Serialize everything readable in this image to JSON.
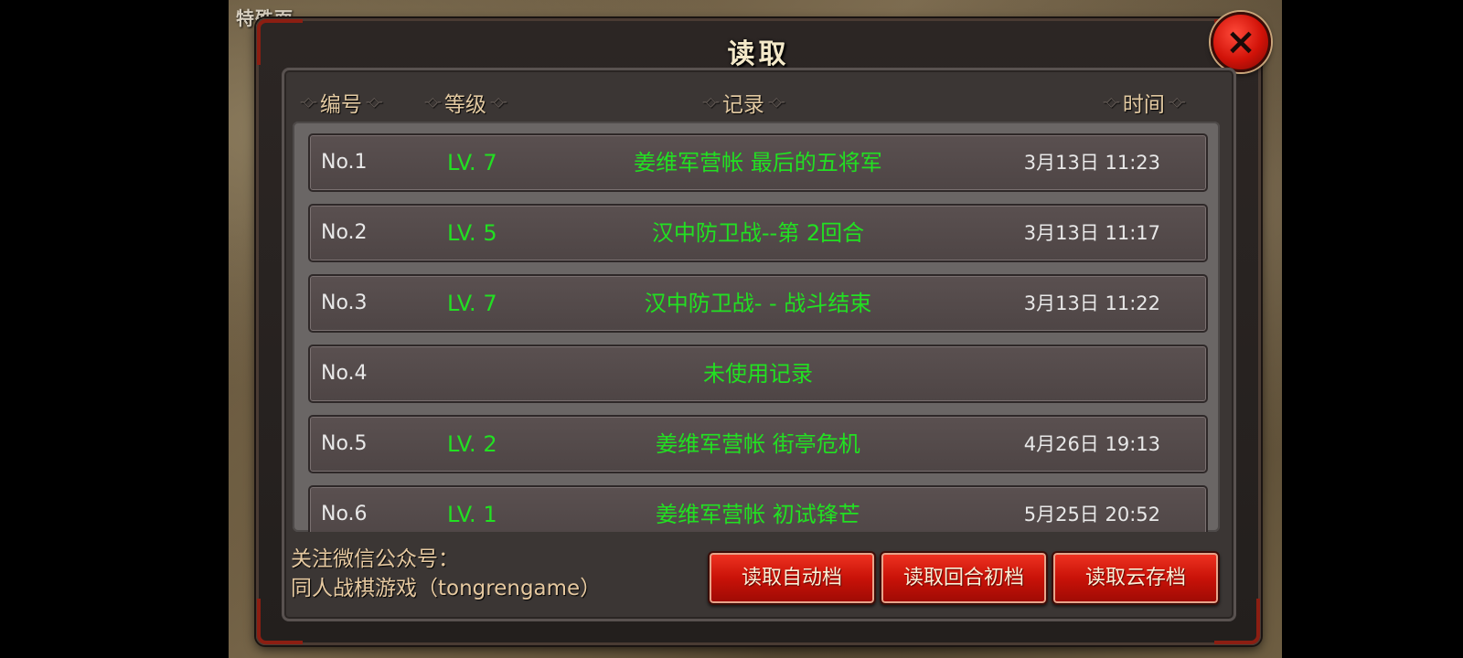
{
  "dialog": {
    "title": "读取",
    "close_icon": "×"
  },
  "background": {
    "corner_text": "特殊面"
  },
  "headers": {
    "number": "编号",
    "level": "等级",
    "record": "记录",
    "time": "时间"
  },
  "saves": [
    {
      "no": "No.1",
      "level": "LV. 7",
      "record": "姜维军营帐 最后的五将军",
      "time": "3月13日 11:23"
    },
    {
      "no": "No.2",
      "level": "LV. 5",
      "record": "汉中防卫战--第 2回合",
      "time": "3月13日 11:17"
    },
    {
      "no": "No.3",
      "level": "LV. 7",
      "record": "汉中防卫战- - 战斗结束",
      "time": "3月13日 11:22"
    },
    {
      "no": "No.4",
      "level": "",
      "record": "未使用记录",
      "time": ""
    },
    {
      "no": "No.5",
      "level": "LV. 2",
      "record": "姜维军营帐 街亭危机",
      "time": "4月26日 19:13"
    },
    {
      "no": "No.6",
      "level": "LV. 1",
      "record": "姜维军营帐 初试锋芒",
      "time": "5月25日 20:52"
    }
  ],
  "footer": {
    "line1": "关注微信公众号：",
    "line2": "同人战棋游戏（tongrengame）"
  },
  "buttons": {
    "auto": "读取自动档",
    "round_start": "读取回合初档",
    "cloud": "读取云存档"
  },
  "colors": {
    "record_text": "#22e022",
    "close_button": "#d11208",
    "action_button": "#c91208"
  }
}
